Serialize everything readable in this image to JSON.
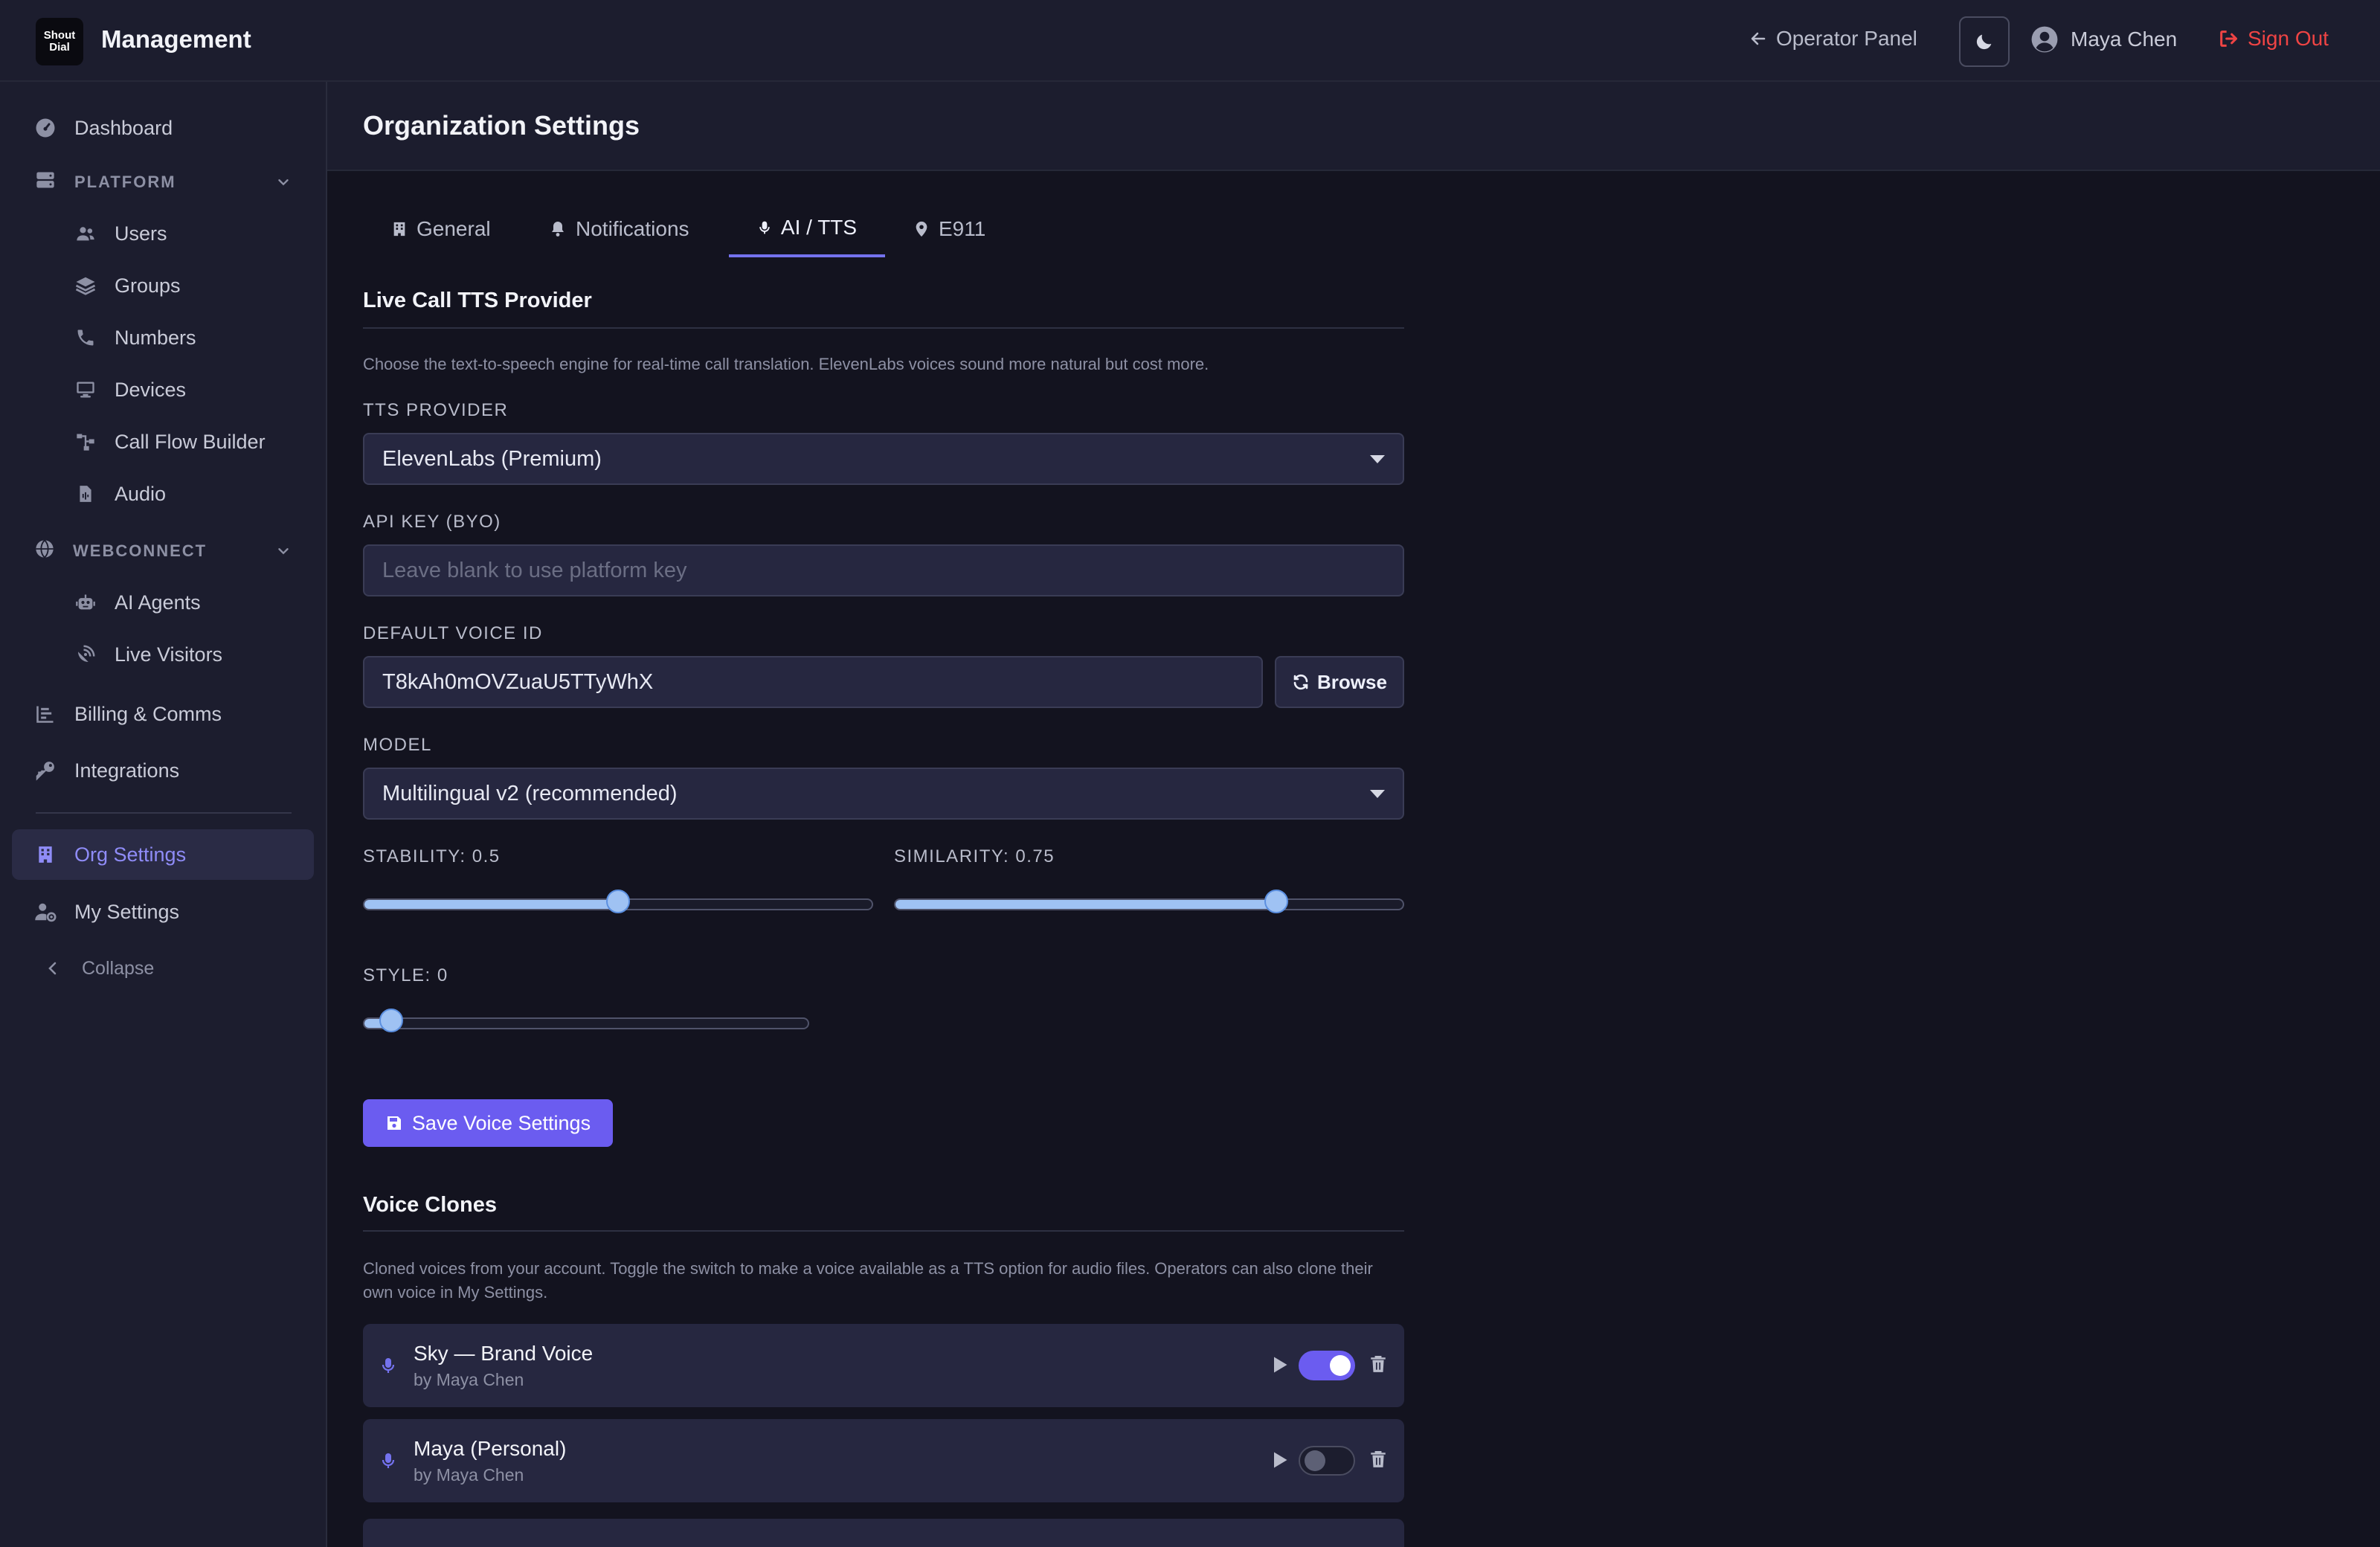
{
  "app": {
    "logo_line1": "Shout",
    "logo_line2": "Dial",
    "title": "Management"
  },
  "topbar": {
    "operator_panel": "Operator Panel",
    "user_name": "Maya Chen",
    "sign_out": "Sign Out"
  },
  "sidebar": {
    "dashboard": "Dashboard",
    "platform_section": "PLATFORM",
    "platform_items": [
      "Users",
      "Groups",
      "Numbers",
      "Devices",
      "Call Flow Builder",
      "Audio"
    ],
    "webconnect_section": "WEBCONNECT",
    "webconnect_items": [
      "AI Agents",
      "Live Visitors"
    ],
    "billing": "Billing & Comms",
    "integrations": "Integrations",
    "org_settings": "Org Settings",
    "my_settings": "My Settings",
    "collapse": "Collapse"
  },
  "page": {
    "title": "Organization Settings"
  },
  "tabs": [
    {
      "label": "General",
      "icon": "building-icon"
    },
    {
      "label": "Notifications",
      "icon": "bell-icon"
    },
    {
      "label": "AI / TTS",
      "icon": "microphone-icon",
      "active": true
    },
    {
      "label": "E911",
      "icon": "map-pin-icon"
    }
  ],
  "tts": {
    "heading": "Live Call TTS Provider",
    "description": "Choose the text-to-speech engine for real-time call translation. ElevenLabs voices sound more natural but cost more.",
    "provider_label": "TTS PROVIDER",
    "provider_value": "ElevenLabs (Premium)",
    "api_key_label": "API KEY (BYO)",
    "api_key_placeholder": "Leave blank to use platform key",
    "voice_id_label": "DEFAULT VOICE ID",
    "voice_id_value": "T8kAh0mOVZuaU5TTyWhX",
    "browse_label": "Browse",
    "model_label": "MODEL",
    "model_value": "Multilingual v2 (recommended)",
    "stability_label": "STABILITY: 0.5",
    "stability_value": 0.5,
    "similarity_label": "SIMILARITY: 0.75",
    "similarity_value": 0.75,
    "style_label": "STYLE: 0",
    "style_value": 0,
    "save_label": "Save Voice Settings"
  },
  "clones": {
    "heading": "Voice Clones",
    "description": "Cloned voices from your account. Toggle the switch to make a voice available as a TTS option for audio files. Operators can also clone their own voice in My Settings.",
    "items": [
      {
        "name": "Sky — Brand Voice",
        "by": "by Maya Chen",
        "enabled": true
      },
      {
        "name": "Maya (Personal)",
        "by": "by Maya Chen",
        "enabled": false
      }
    ]
  },
  "colors": {
    "accent": "#6b5cf0",
    "danger": "#ef4444",
    "slider": "#9fc2f3",
    "background": "#13131f",
    "panel": "#1c1d2e"
  }
}
